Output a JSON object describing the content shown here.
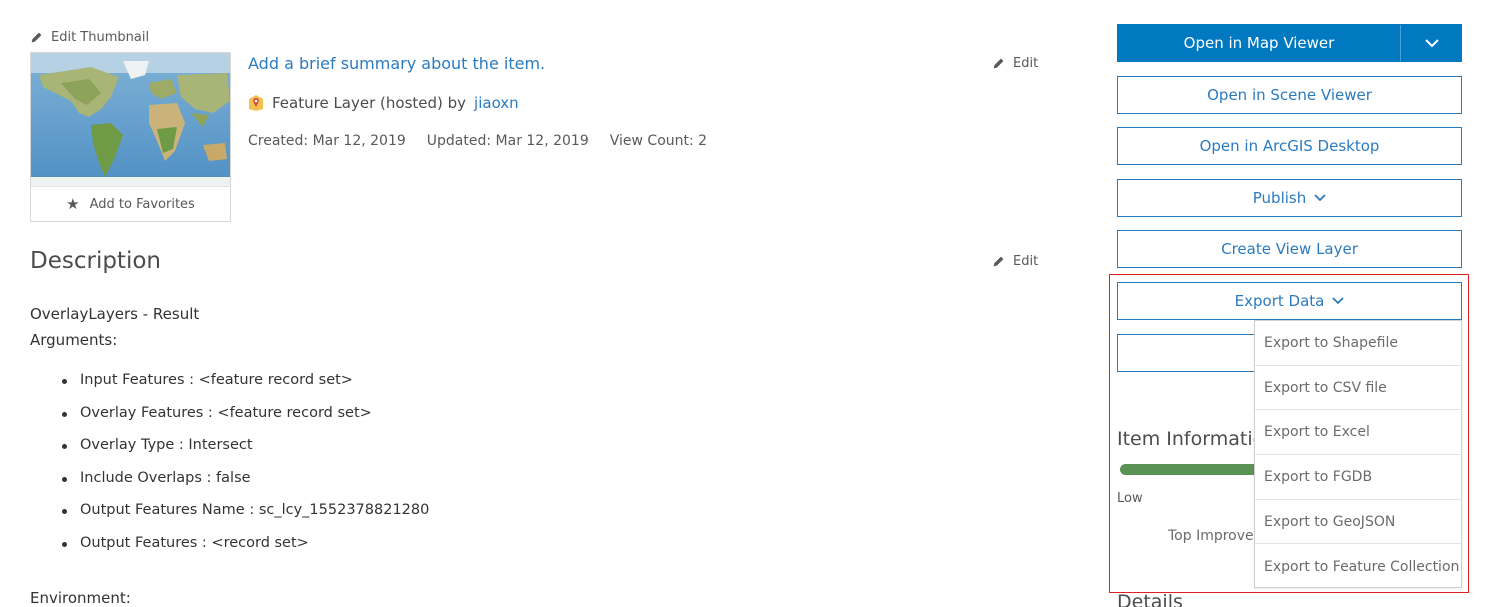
{
  "thumbnail": {
    "edit_label": "Edit Thumbnail",
    "favorites_label": "Add to Favorites"
  },
  "summary": {
    "text": "Add a brief summary about the item.",
    "edit_label": "Edit"
  },
  "layer": {
    "type_text": "Feature Layer (hosted) by",
    "owner": "jiaoxn"
  },
  "meta": {
    "created": "Created: Mar 12, 2019",
    "updated": "Updated: Mar 12, 2019",
    "view_count": "View Count: 2"
  },
  "description": {
    "title": "Description",
    "edit_label": "Edit",
    "line1": "OverlayLayers - Result",
    "line2": "Arguments:",
    "args": [
      "Input Features : <feature record set>",
      "Overlay Features : <feature record set>",
      "Overlay Type : Intersect",
      "Include Overlaps : false",
      "Output Features Name : sc_lcy_1552378821280",
      "Output Features : <record set>"
    ],
    "environment": "Environment:"
  },
  "buttons": {
    "open_map_viewer": "Open in Map Viewer",
    "open_scene_viewer": "Open in Scene Viewer",
    "open_arcgis_desktop": "Open in ArcGIS Desktop",
    "publish": "Publish",
    "create_view_layer": "Create View Layer",
    "export_data": "Export Data"
  },
  "export_menu": [
    "Export to Shapefile",
    "Export to CSV file",
    "Export to Excel",
    "Export to FGDB",
    "Export to GeoJSON",
    "Export to Feature Collection"
  ],
  "item_info": {
    "title": "Item Information",
    "score_label": "Low",
    "top_improve": "Top Improvements",
    "score_fraction": 0.39
  },
  "details": {
    "title": "Details"
  },
  "colors": {
    "accent": "#0079c1",
    "link": "#2b7bbf",
    "highlight": "#e02020",
    "progress": "#5a9155"
  }
}
